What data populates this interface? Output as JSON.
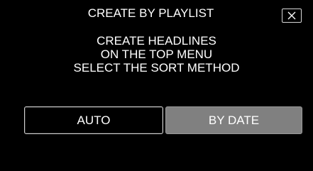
{
  "dialog": {
    "title": "CREATE BY PLAYLIST",
    "message_lines": [
      "CREATE HEADLINES",
      "ON THE TOP MENU",
      "SELECT THE SORT METHOD"
    ]
  },
  "buttons": {
    "auto_label": "AUTO",
    "by_date_label": "BY DATE"
  },
  "icons": {
    "close": "close-icon"
  },
  "colors": {
    "background": "#000000",
    "text": "#ffffff",
    "selected_button": "#808080"
  }
}
